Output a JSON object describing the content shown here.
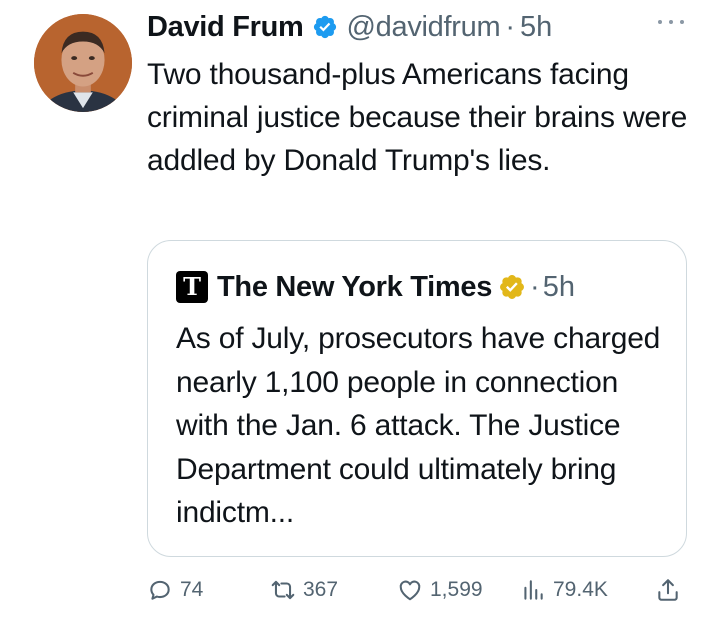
{
  "tweet": {
    "author_name": "David Frum",
    "handle": "@davidfrum",
    "dot": "·",
    "time": "5h",
    "text": "Two thousand-plus Americans facing criminal justice because their brains were addled by Donald Trump's lies."
  },
  "quote": {
    "logo_letter": "T",
    "author_name": "The New York Times",
    "dot": "·",
    "time": "5h",
    "text": "As of July, prosecutors have charged nearly 1,100 people in connection with the Jan. 6 attack. The Justice Department could ultimately bring indictm..."
  },
  "actions": {
    "replies": "74",
    "reposts": "367",
    "likes": "1,599",
    "views": "79.4K"
  },
  "icons": {
    "avatar": "profile-photo",
    "verified": "blue-check-icon",
    "quote_verified": "gold-check-icon",
    "more": "more-icon",
    "reply": "reply-icon",
    "repost": "repost-icon",
    "like": "heart-icon",
    "views": "views-icon",
    "share": "share-icon"
  },
  "colors": {
    "text": "#0f1419",
    "secondary": "#536471",
    "blue_verified": "#1d9bf0",
    "gold_verified": "#e2b719",
    "border": "#cfd9de"
  }
}
